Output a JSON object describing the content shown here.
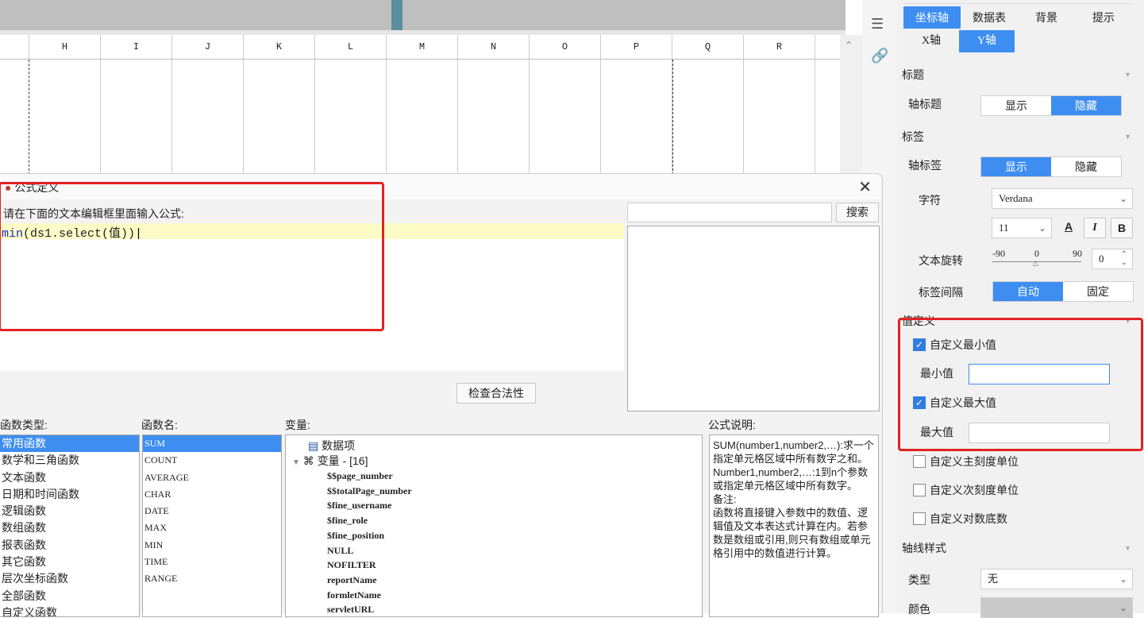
{
  "spreadsheet": {
    "columns": [
      "H",
      "I",
      "J",
      "K",
      "L",
      "M",
      "N",
      "O",
      "P",
      "Q",
      "R"
    ]
  },
  "right_panel": {
    "tabs_row2": [
      "坐标轴",
      "数据表",
      "背景",
      "提示"
    ],
    "axis_tabs": [
      "X轴",
      "Y轴"
    ],
    "title_section": "标题",
    "axis_title_label": "轴标题",
    "axis_title_options": [
      "显示",
      "隐藏"
    ],
    "label_section": "标签",
    "axis_label_label": "轴标签",
    "axis_label_options": [
      "显示",
      "隐藏"
    ],
    "font_label": "字符",
    "font_value": "Verdana",
    "font_size": "11",
    "bold_label": "B",
    "italic_label": "I",
    "color_label": "A",
    "rotation_label": "文本旋转",
    "rotation_ticks": [
      "-90",
      "0",
      "90"
    ],
    "rotation_value": "0",
    "interval_label": "标签间隔",
    "interval_options": [
      "自动",
      "固定"
    ],
    "value_def_section": "值定义",
    "custom_min_label": "自定义最小值",
    "custom_min_checked": true,
    "min_label": "最小值",
    "custom_max_label": "自定义最大值",
    "custom_max_checked": true,
    "max_label": "最大值",
    "custom_major_label": "自定义主刻度单位",
    "custom_minor_label": "自定义次刻度单位",
    "custom_log_label": "自定义对数底数",
    "axis_style_section": "轴线样式",
    "type_label": "类型",
    "type_value": "无",
    "color_row_label": "颜色"
  },
  "dialog": {
    "title": "公式定义",
    "prompt": "请在下面的文本编辑框里面输入公式:",
    "formula_keyword": "min",
    "formula_body": "(ds1.select(值))",
    "search_button": "搜索",
    "check_button": "检查合法性",
    "func_type_header": "函数类型:",
    "func_name_header": "函数名:",
    "variable_header": "变量:",
    "formula_desc_header": "公式说明:",
    "func_types": [
      "常用函数",
      "数学和三角函数",
      "文本函数",
      "日期和时间函数",
      "逻辑函数",
      "数组函数",
      "报表函数",
      "其它函数",
      "层次坐标函数",
      "全部函数",
      "自定义函数"
    ],
    "func_names": [
      "SUM",
      "COUNT",
      "AVERAGE",
      "CHAR",
      "DATE",
      "MAX",
      "MIN",
      "TIME",
      "RANGE"
    ],
    "variables": {
      "data_item": "数据项",
      "var_group": "变量 - [16]",
      "items": [
        "$$page_number",
        "$$totalPage_number",
        "$fine_username",
        "$fine_role",
        "$fine_position",
        "NULL",
        "NOFILTER",
        "reportName",
        "formletName",
        "servletURL"
      ]
    },
    "description": "SUM(number1,number2,…):求一个指定单元格区域中所有数字之和。\nNumber1,number2,…:1到n个参数或指定单元格区域中所有数字。\n备注:\n函数将直接键入参数中的数值、逻辑值及文本表达式计算在内。若参数是数组或引用,则只有数组或单元格引用中的数值进行计算。"
  }
}
